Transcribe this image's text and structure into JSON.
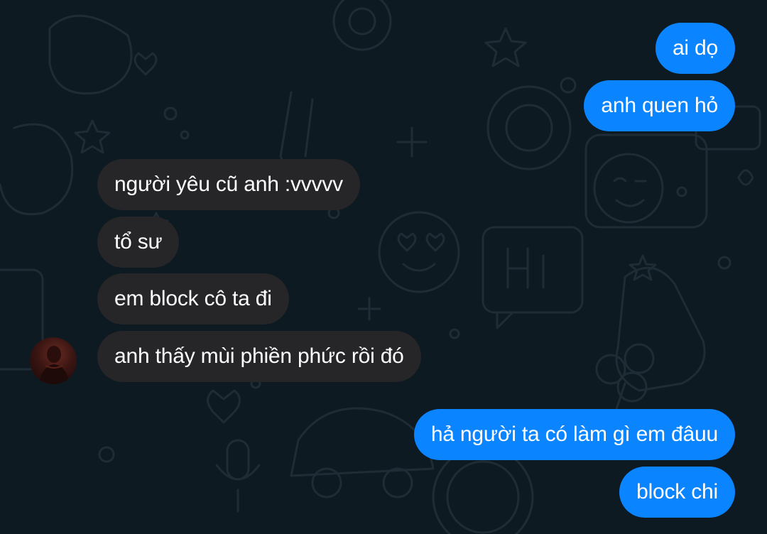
{
  "theme": {
    "background": "#0e1a22",
    "outgoing_bubble_color": "#0a84ff",
    "incoming_bubble_color": "#262528",
    "text_color": "#ffffff"
  },
  "messages": [
    {
      "direction": "outgoing",
      "text": "ai dọ"
    },
    {
      "direction": "outgoing",
      "text": "anh quen hỏ"
    },
    {
      "direction": "incoming",
      "text": "người yêu cũ anh :vvvvv"
    },
    {
      "direction": "incoming",
      "text": "tổ sư"
    },
    {
      "direction": "incoming",
      "text": "em block cô ta đi"
    },
    {
      "direction": "incoming",
      "text": "anh thấy mùi phiền phức rồi đó"
    },
    {
      "direction": "outgoing",
      "text": "hả người ta có làm gì em đâuu"
    },
    {
      "direction": "outgoing",
      "text": "block chi"
    }
  ],
  "avatar": {
    "icon": "contact-avatar"
  }
}
